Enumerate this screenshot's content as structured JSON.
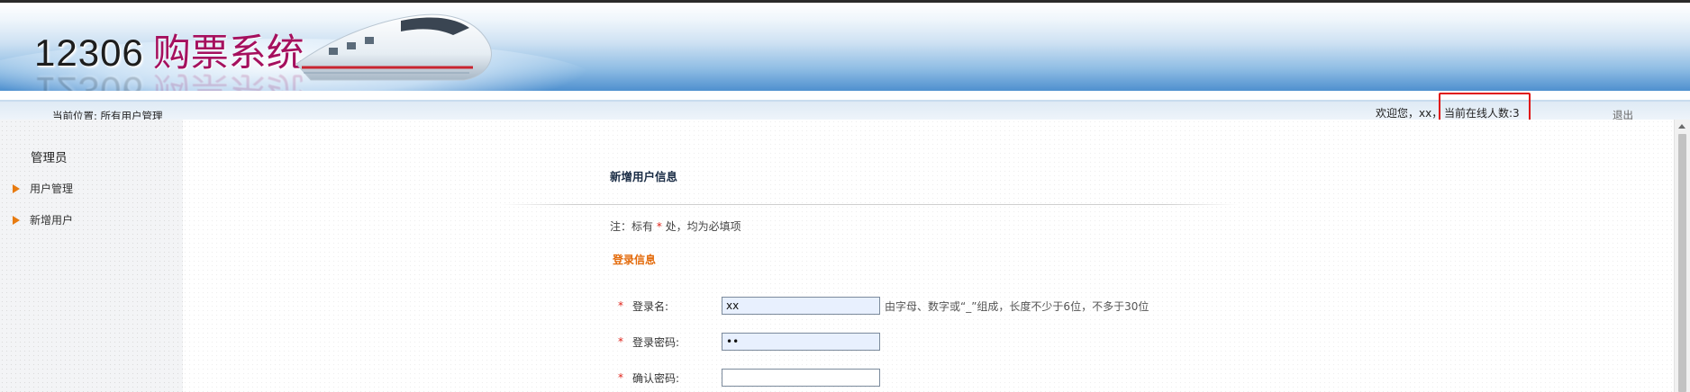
{
  "header": {
    "logo_number": "12306",
    "logo_text": "购票系统"
  },
  "location": {
    "text": "当前位置: 所有用户管理"
  },
  "user_bar": {
    "welcome": "欢迎您，xx，",
    "online_count": "当前在线人数:3",
    "logout": "退出"
  },
  "sidebar": {
    "title": "管理员",
    "items": [
      {
        "label": "用户管理"
      },
      {
        "label": "新增用户"
      }
    ]
  },
  "form": {
    "title": "新增用户信息",
    "note_prefix": "注：标有 ",
    "note_star": "*",
    "note_suffix": " 处，均为必填项",
    "section": "登录信息",
    "fields": [
      {
        "required": "*",
        "label": "登录名:",
        "value": "xx",
        "hint": "由字母、数字或“_”组成，长度不少于6位，不多于30位"
      },
      {
        "required": "*",
        "label": "登录密码:",
        "value": "••",
        "hint": ""
      },
      {
        "required": "*",
        "label": "确认密码:",
        "value": "",
        "hint": ""
      }
    ]
  },
  "colors": {
    "brand_magenta": "#a5105e",
    "accent_orange": "#e36a0a",
    "required_red": "#e0241b",
    "highlight_box": "#e01010"
  }
}
